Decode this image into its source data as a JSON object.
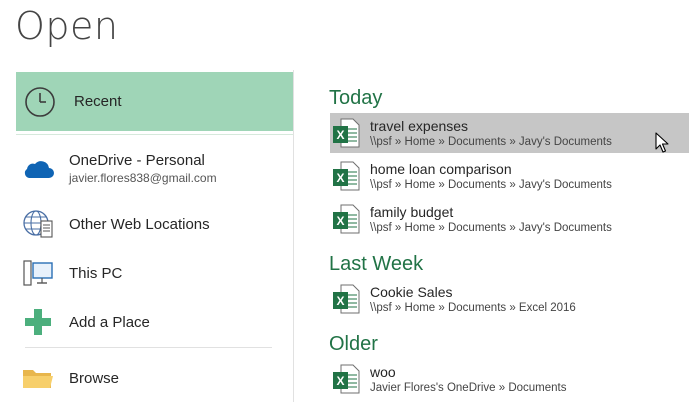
{
  "title": "Open",
  "places": {
    "recent": {
      "label": "Recent",
      "icon": "clock-icon"
    },
    "onedrive": {
      "label": "OneDrive - Personal",
      "email": "javier.flores838@gmail.com",
      "icon": "cloud-icon"
    },
    "other_web": {
      "label": "Other Web Locations",
      "icon": "globe-icon"
    },
    "this_pc": {
      "label": "This PC",
      "icon": "computer-icon"
    },
    "add_place": {
      "label": "Add a Place",
      "icon": "plus-icon"
    },
    "browse": {
      "label": "Browse",
      "icon": "folder-icon"
    }
  },
  "groups": [
    {
      "heading": "Today",
      "files": [
        {
          "name": "travel expenses",
          "path": "\\\\psf » Home » Documents » Javy's Documents",
          "selected": true
        },
        {
          "name": "home loan comparison",
          "path": "\\\\psf » Home » Documents » Javy's Documents"
        },
        {
          "name": "family budget",
          "path": "\\\\psf » Home » Documents » Javy's Documents"
        }
      ]
    },
    {
      "heading": "Last Week",
      "files": [
        {
          "name": "Cookie Sales",
          "path": "\\\\psf » Home » Documents » Excel 2016"
        }
      ]
    },
    {
      "heading": "Older",
      "files": [
        {
          "name": "woo",
          "path": "Javier Flores's OneDrive » Documents"
        }
      ]
    }
  ],
  "colors": {
    "accent": "#217346",
    "selected_place": "#9fd5b7",
    "selected_file": "#c6c6c6"
  }
}
